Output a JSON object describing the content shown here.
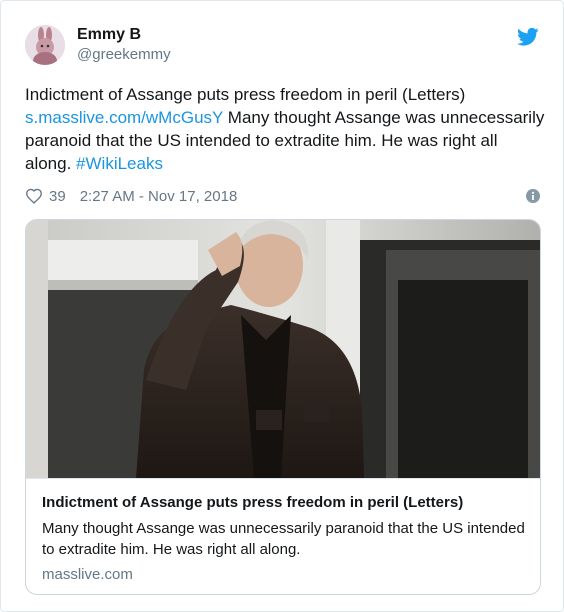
{
  "author": {
    "name": "Emmy B",
    "handle": "@greekemmy"
  },
  "tweet": {
    "text_plain": "Indictment of Assange puts press freedom in peril (Letters)",
    "link": "s.masslive.com/wMcGusY",
    "text_rest": " Many thought Assange was unnecessarily paranoid that the US intended to extradite him. He was right all along. ",
    "hashtag": "#WikiLeaks",
    "likes": "39",
    "timestamp": "2:27 AM - Nov 17, 2018"
  },
  "card": {
    "title": "Indictment of Assange puts press freedom in peril (Letters)",
    "description": "Many thought Assange was unnecessarily paranoid that the US intended to extradite him. He was right all along.",
    "domain": "masslive.com"
  },
  "colors": {
    "link": "#1b95e0",
    "muted": "#657786",
    "twitter_blue": "#1da1f2"
  },
  "icons": {
    "logo": "twitter-bird-icon",
    "like": "heart-icon",
    "info": "info-icon"
  }
}
